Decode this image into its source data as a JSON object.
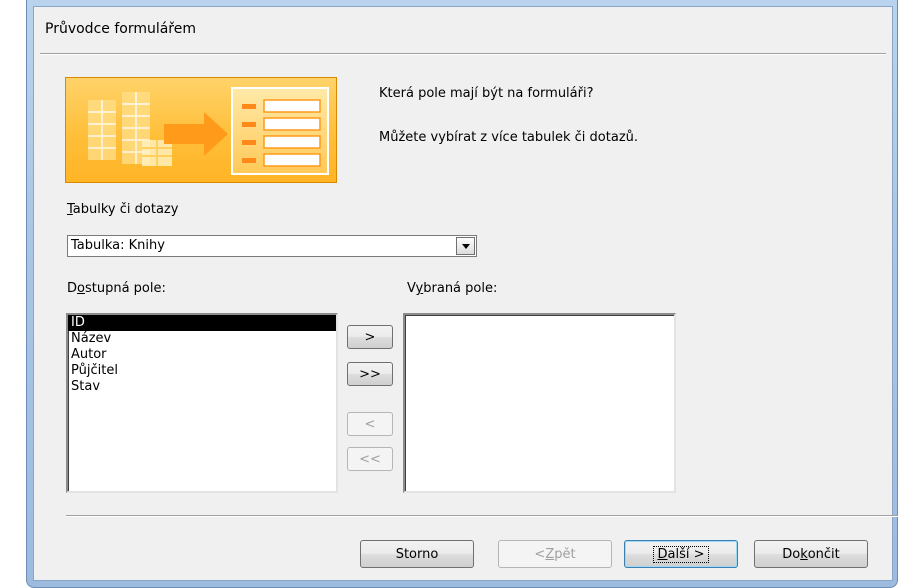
{
  "window": {
    "title": "Průvodce formulářem"
  },
  "intro": {
    "question": "Která pole mají být na formuláři?",
    "hint": "Můžete vybírat z více tabulek či dotazů."
  },
  "source": {
    "label_accel": "T",
    "label_rest": "abulky či dotazy",
    "selected": "Tabulka: Knihy"
  },
  "available": {
    "label_pre": "D",
    "label_accel": "o",
    "label_rest": "stupná pole:",
    "items": [
      "ID",
      "Název",
      "Autor",
      "Půjčitel",
      "Stav"
    ],
    "selected_index": 0
  },
  "selected_fields": {
    "label_pre": "V",
    "label_accel": "y",
    "label_rest": "braná pole:",
    "items": []
  },
  "move_buttons": {
    "add_one": ">",
    "add_all": ">>",
    "remove_one": "<",
    "remove_all": "<<"
  },
  "footer": {
    "cancel": "Storno",
    "back_pre": "< ",
    "back_accel": "Z",
    "back_rest": "pět",
    "next_accel": "D",
    "next_rest": "alší >",
    "finish_pre": "Do",
    "finish_accel": "k",
    "finish_rest": "ončit"
  },
  "colors": {
    "banner_orange": "#ffbf3a",
    "selection": "#000000"
  },
  "icons": [
    "form-wizard-banner-illustration",
    "dropdown-arrow-icon"
  ]
}
